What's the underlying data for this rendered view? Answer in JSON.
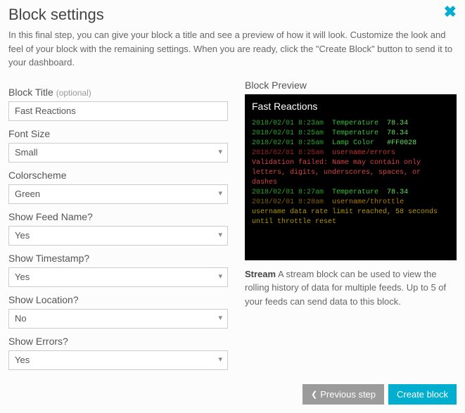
{
  "header": {
    "title": "Block settings",
    "description": "In this final step, you can give your block a title and see a preview of how it will look. Customize the look and feel of your block with the remaining settings. When you are ready, click the \"Create Block\" button to send it to your dashboard."
  },
  "form": {
    "blockTitle": {
      "label": "Block Title",
      "optional": "(optional)",
      "value": "Fast Reactions"
    },
    "fontSize": {
      "label": "Font Size",
      "value": "Small"
    },
    "colorScheme": {
      "label": "Colorscheme",
      "value": "Green"
    },
    "showFeed": {
      "label": "Show Feed Name?",
      "value": "Yes"
    },
    "showTime": {
      "label": "Show Timestamp?",
      "value": "Yes"
    },
    "showLoc": {
      "label": "Show Location?",
      "value": "No"
    },
    "showErr": {
      "label": "Show Errors?",
      "value": "Yes"
    }
  },
  "preview": {
    "label": "Block Preview",
    "title": "Fast Reactions",
    "lines": [
      {
        "ts": "2018/02/01 8:23am",
        "feed": "Temperature",
        "val": "78.34",
        "cls": "ok"
      },
      {
        "ts": "2018/02/01 8:25am",
        "feed": "Temperature",
        "val": "78.34",
        "cls": "ok"
      },
      {
        "ts": "2018/02/01 8:25am",
        "feed": "Lamp Color",
        "val": "#FF0028",
        "cls": "lamp"
      },
      {
        "ts": "2018/02/01 8:25am",
        "feed": "username/errors",
        "val": "",
        "cls": "err"
      },
      {
        "msg": "Validation failed: Name may contain only letters, digits, underscores, spaces, or dashes",
        "cls": "err-msg"
      },
      {
        "ts": "2018/02/01 8:27am",
        "feed": "Temperature",
        "val": "78.34",
        "cls": "ok"
      },
      {
        "ts": "2018/02/01 8:28am",
        "feed": "username/throttle",
        "val": "",
        "cls": "warn"
      },
      {
        "msg": "username data rate limit reached, 58 seconds until throttle reset",
        "cls": "warn-msg"
      }
    ],
    "descBold": "Stream",
    "desc": " A stream block can be used to view the rolling history of data for multiple feeds. Up to 5 of your feeds can send data to this block."
  },
  "footer": {
    "prev": "Previous step",
    "create": "Create block"
  }
}
